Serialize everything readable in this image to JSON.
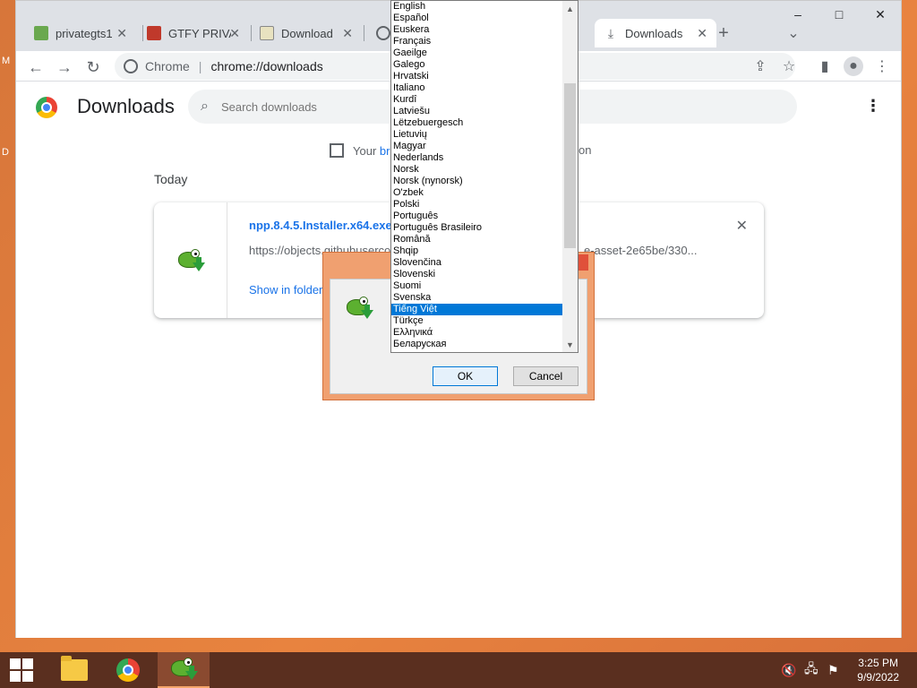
{
  "browser": {
    "tabs": [
      {
        "label": "privategts1",
        "icon": "game-favicon"
      },
      {
        "label": "GTFY PRIVA",
        "icon": "mario-favicon"
      },
      {
        "label": "Download",
        "icon": "notepad-favicon"
      },
      {
        "label": "",
        "icon": "globe-favicon"
      },
      {
        "label": "Downloads",
        "icon": "download-favicon"
      }
    ],
    "new_tab": "+",
    "tab_search": "⌄",
    "window": {
      "minimize": "–",
      "maximize": "□",
      "close": "✕"
    },
    "nav": {
      "back": "←",
      "forward": "→",
      "reload": "↻"
    },
    "omnibox": {
      "site_name": "Chrome",
      "separator": "|",
      "url": "chrome://downloads"
    },
    "toolbar_icons": {
      "share": "⇪",
      "star": "☆",
      "side_panel": "▮",
      "profile": "●",
      "menu": "⋮"
    }
  },
  "page": {
    "title": "Downloads",
    "search_placeholder": "Search downloads",
    "menu_icon": "⋮",
    "managed_prefix": "Your",
    "managed_link": "br",
    "managed_tail": "on",
    "day": "Today",
    "download": {
      "filename": "npp.8.4.5.Installer.x64.exe",
      "url_start": "https://objects.githubuserco",
      "url_end": "e-asset-2e65be/330...",
      "action": "Show in folder",
      "close": "✕"
    }
  },
  "dialog": {
    "ok": "OK",
    "cancel": "Cancel"
  },
  "languages": {
    "items": [
      "English",
      "Español",
      "Euskera",
      "Français",
      "Gaeilge",
      "Galego",
      "Hrvatski",
      "Italiano",
      "Kurdî",
      "Latviešu",
      "Lëtzebuergesch",
      "Lietuvių",
      "Magyar",
      "Nederlands",
      "Norsk",
      "Norsk (nynorsk)",
      "O'zbek",
      "Polski",
      "Português",
      "Português Brasileiro",
      "Română",
      "Shqip",
      "Slovenčina",
      "Slovenski",
      "Suomi",
      "Svenska",
      "Tiếng Việt",
      "Türkçe",
      "Ελληνικά",
      "Беларуская"
    ],
    "selected": "Tiếng Việt",
    "scroll_up": "▲",
    "scroll_down": "▼"
  },
  "desktop": {
    "edge_left_1": "M",
    "edge_left_2": "D"
  },
  "taskbar": {
    "time": "3:25 PM",
    "date": "9/9/2022",
    "tray": {
      "volume": "🔇",
      "network": "🖧",
      "flag": "⚑"
    }
  },
  "colors": {
    "accent": "#1a73e8",
    "desktop": "#e8833f",
    "taskbar": "#5a2f1f",
    "selection": "#0078d7"
  }
}
